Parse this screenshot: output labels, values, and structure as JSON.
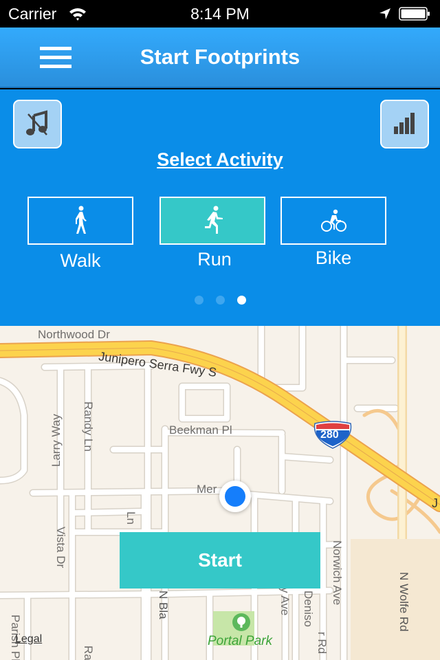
{
  "status_bar": {
    "carrier": "Carrier",
    "time": "8:14 PM",
    "icons": [
      "wifi-icon",
      "location-arrow-icon",
      "battery-icon"
    ]
  },
  "nav_bar": {
    "title": "Start Footprints",
    "menu_icon": "hamburger-menu-icon"
  },
  "activity_panel": {
    "mute_music_icon": "music-muted-icon",
    "stats_icon": "signal-bars-icon",
    "title": "Select Activity",
    "activities": [
      {
        "label": "Walk",
        "icon": "walk-icon",
        "selected": false
      },
      {
        "label": "Run",
        "icon": "run-icon",
        "selected": true
      },
      {
        "label": "Bike",
        "icon": "bike-icon",
        "selected": false
      }
    ],
    "page_indicator": {
      "count": 3,
      "current": 3
    }
  },
  "map": {
    "labels": {
      "northwood": "Northwood Dr",
      "junipero": "Junipero Serra Fwy S",
      "larry": "Larry Way",
      "randy": "Randy Ln",
      "beekman": "Beekman Pl",
      "mer": "Mer",
      "vista": "Vista Dr",
      "lane": "Ln",
      "norwich": "Norwich Ave",
      "nwolfe": "N Wolfe Rd",
      "nblaney": "N Bla",
      "ave": "y Ave",
      "deniso": "Deniso",
      "rd": "r Rd",
      "parish": "Parish Pl",
      "ra": "Ra",
      "portal_park": "Portal Park",
      "j": "J",
      "highway_shield": "280"
    },
    "legal_link": "Legal",
    "colors": {
      "land": "#f7f2ea",
      "freeway": "#fcd34d",
      "user_location": "#157efb",
      "park": "#c7e6a8"
    }
  },
  "start_button": {
    "label": "Start",
    "color": "#35c8c8"
  }
}
